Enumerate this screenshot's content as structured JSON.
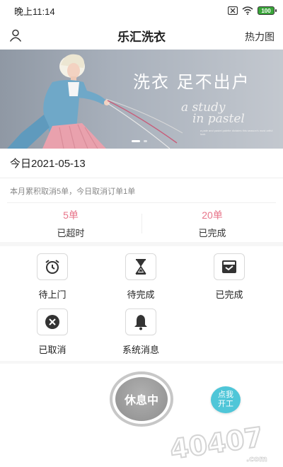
{
  "status_bar": {
    "time": "晚上11:14",
    "battery": "100",
    "icons": [
      "sim-x-icon",
      "wifi-icon",
      "battery-icon"
    ]
  },
  "header": {
    "title": "乐汇洗衣",
    "right_link": "热力图",
    "left_icon": "profile-icon"
  },
  "banner": {
    "headline": "洗衣  足不出户",
    "script_line1": "a study",
    "script_line2": "in pastel",
    "fine_print": "a pale and pastel palette dictates this season's most artful look",
    "slide_count": 2,
    "active_slide": 1
  },
  "date": {
    "text": "今日2021-05-13"
  },
  "cancel_info": {
    "text": "本月累积取消5单，今日取消订单1单"
  },
  "stats": [
    {
      "number": "5单",
      "label": "已超时"
    },
    {
      "number": "20单",
      "label": "已完成"
    }
  ],
  "grid": [
    {
      "label": "待上门",
      "icon": "alarm-clock-icon"
    },
    {
      "label": "待完成",
      "icon": "hourglass-icon"
    },
    {
      "label": "已完成",
      "icon": "inbox-check-icon"
    },
    {
      "label": "已取消",
      "icon": "cancel-circle-icon"
    },
    {
      "label": "系统消息",
      "icon": "bell-icon"
    }
  ],
  "rest_button": {
    "label": "休息中"
  },
  "start_button": {
    "line1": "点我",
    "line2": "开工"
  },
  "watermark": {
    "text": "40407",
    "suffix": ".com"
  },
  "colors": {
    "accent_pink": "#e8758a",
    "start_cyan": "#4fc6d8",
    "rest_gray": "#9e9e9e"
  }
}
